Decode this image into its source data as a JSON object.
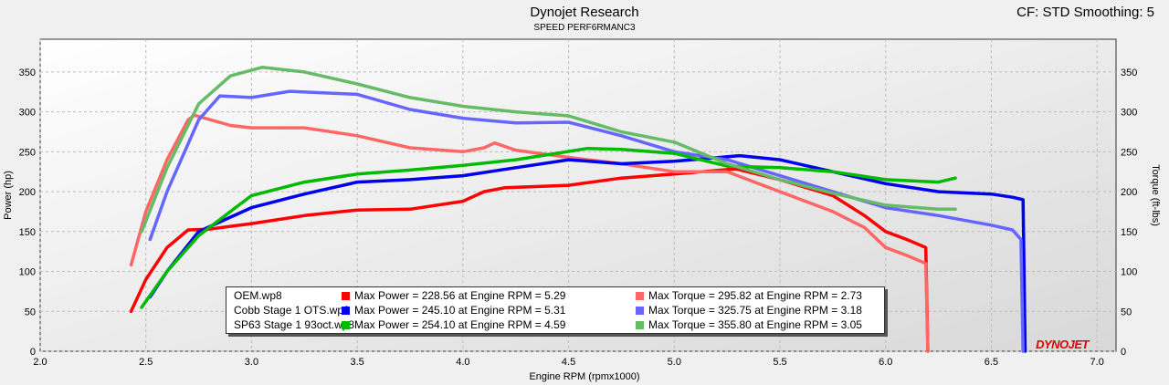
{
  "header": {
    "title": "Dynojet Research",
    "subtitle": "SPEED PERF6RMANC3",
    "settings": "CF: STD Smoothing: 5"
  },
  "logo": "DYNOJET",
  "chart_data": {
    "type": "line",
    "title": "Dynojet Research",
    "xlabel": "Engine RPM (rpmx1000)",
    "ylabel": "Power (hp)",
    "y2label": "Torque (ft-lbs)",
    "xlim": [
      2.0,
      7.09
    ],
    "ylim": [
      0,
      391
    ],
    "xticks": [
      "2.0",
      "2.5",
      "3.0",
      "3.5",
      "4.0",
      "4.5",
      "5.0",
      "5.5",
      "6.0",
      "6.5",
      "7.0"
    ],
    "yticks": [
      "0",
      "50",
      "100",
      "150",
      "200",
      "250",
      "300",
      "350"
    ],
    "grid": true,
    "legend_position": "bottom-center",
    "series": [
      {
        "name": "OEM.wp8",
        "kind": "power",
        "color": "#ff0000",
        "x": [
          2.43,
          2.5,
          2.6,
          2.7,
          2.8,
          3.0,
          3.25,
          3.5,
          3.75,
          4.0,
          4.1,
          4.2,
          4.5,
          4.75,
          5.0,
          5.29,
          5.5,
          5.75,
          5.9,
          6.0,
          6.1,
          6.19,
          6.2
        ],
        "y": [
          50,
          90,
          130,
          152,
          153,
          160,
          170,
          177,
          178,
          188,
          200,
          205,
          208,
          217,
          222,
          228.56,
          215,
          195,
          170,
          150,
          140,
          130,
          0
        ]
      },
      {
        "name": "OEM.wp8",
        "kind": "torque",
        "color": "#ff6666",
        "x": [
          2.43,
          2.5,
          2.6,
          2.7,
          2.73,
          2.9,
          3.0,
          3.25,
          3.5,
          3.75,
          4.0,
          4.1,
          4.15,
          4.25,
          4.5,
          4.75,
          5.0,
          5.25,
          5.5,
          5.75,
          5.9,
          6.0,
          6.1,
          6.19,
          6.2
        ],
        "y": [
          108,
          175,
          240,
          290,
          295.82,
          283,
          280,
          280,
          270,
          255,
          250,
          255,
          261,
          252,
          243,
          235,
          225,
          225,
          200,
          175,
          155,
          130,
          120,
          110,
          0
        ]
      },
      {
        "name": "Cobb Stage 1 OTS.wp8",
        "kind": "power",
        "color": "#0000ee",
        "x": [
          2.52,
          2.6,
          2.75,
          3.0,
          3.25,
          3.5,
          3.75,
          4.0,
          4.25,
          4.5,
          4.75,
          5.0,
          5.31,
          5.5,
          5.75,
          6.0,
          6.25,
          6.5,
          6.6,
          6.65,
          6.66
        ],
        "y": [
          68,
          100,
          150,
          180,
          197,
          212,
          215,
          220,
          230,
          240,
          235,
          238,
          245.1,
          240,
          225,
          210,
          200,
          197,
          193,
          190,
          0
        ]
      },
      {
        "name": "Cobb Stage 1 OTS.wp8",
        "kind": "torque",
        "color": "#6666ff",
        "x": [
          2.52,
          2.6,
          2.75,
          2.85,
          3.0,
          3.18,
          3.5,
          3.75,
          4.0,
          4.25,
          4.5,
          4.75,
          5.0,
          5.25,
          5.5,
          5.75,
          6.0,
          6.25,
          6.5,
          6.6,
          6.64,
          6.65
        ],
        "y": [
          140,
          200,
          290,
          320,
          318,
          325.75,
          322,
          303,
          292,
          286,
          287,
          270,
          250,
          240,
          220,
          200,
          180,
          170,
          158,
          152,
          140,
          0
        ]
      },
      {
        "name": "SP63 Stage 1 93oct.wp8",
        "kind": "power",
        "color": "#00bb00",
        "x": [
          2.48,
          2.6,
          2.75,
          3.0,
          3.25,
          3.5,
          3.75,
          4.0,
          4.25,
          4.59,
          4.75,
          5.0,
          5.25,
          5.5,
          5.75,
          6.0,
          6.25,
          6.33
        ],
        "y": [
          55,
          100,
          145,
          195,
          212,
          222,
          227,
          233,
          240,
          254.1,
          253,
          248,
          232,
          230,
          225,
          215,
          212,
          217
        ]
      },
      {
        "name": "SP63 Stage 1 93oct.wp8",
        "kind": "torque",
        "color": "#66bb66",
        "x": [
          2.48,
          2.6,
          2.75,
          2.9,
          3.05,
          3.25,
          3.5,
          3.75,
          4.0,
          4.25,
          4.5,
          4.75,
          5.0,
          5.25,
          5.5,
          5.75,
          6.0,
          6.25,
          6.33
        ],
        "y": [
          150,
          230,
          310,
          345,
          355.8,
          350,
          335,
          318,
          307,
          300,
          295,
          275,
          262,
          235,
          215,
          198,
          183,
          178,
          178
        ]
      }
    ],
    "legend": [
      {
        "name": "OEM.wp8",
        "power_color": "#ff0000",
        "torque_color": "#ff6666",
        "max_power": "Max Power = 228.56 at Engine RPM = 5.29",
        "max_torque": "Max Torque = 295.82 at Engine RPM = 2.73"
      },
      {
        "name": "Cobb Stage 1 OTS.wp8",
        "power_color": "#0000ee",
        "torque_color": "#6666ff",
        "max_power": "Max Power = 245.10 at Engine RPM = 5.31",
        "max_torque": "Max Torque = 325.75 at Engine RPM = 3.18"
      },
      {
        "name": "SP63 Stage 1 93oct.wp8",
        "power_color": "#00bb00",
        "torque_color": "#66bb66",
        "max_power": "Max Power = 254.10 at Engine RPM = 4.59",
        "max_torque": "Max Torque = 355.80 at Engine RPM = 3.05"
      }
    ]
  }
}
